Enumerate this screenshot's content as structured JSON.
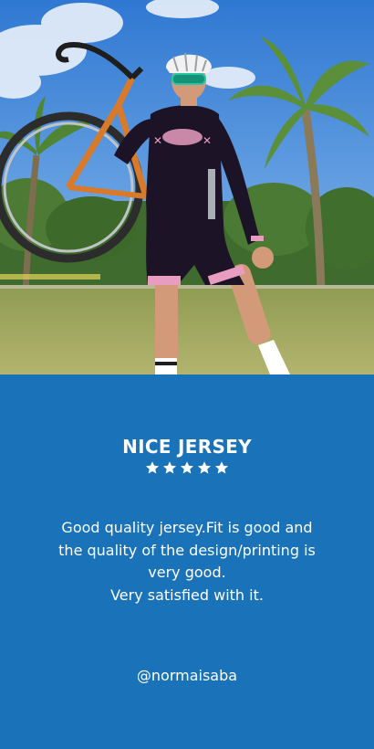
{
  "review": {
    "title": "NICE JERSEY",
    "rating": 5,
    "rating_max": 5,
    "text_lines": [
      "Good quality jersey.Fit is good and",
      "the quality of the design/printing is",
      "very good.",
      "Very satisfied with it."
    ],
    "author_handle": "@normaisaba"
  },
  "colors": {
    "panel_background": "#1a72b9",
    "text": "#ffffff",
    "sky": "#3f86d8",
    "grass": "#9aa45a",
    "jersey_accent": "#e79cc0",
    "bike_frame": "#d9792a"
  },
  "icons": {
    "star": "star-icon"
  }
}
